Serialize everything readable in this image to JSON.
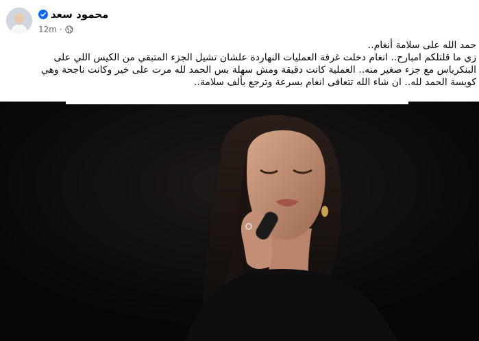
{
  "post": {
    "author": {
      "name": "محمود سعد",
      "verified": true,
      "avatar_icon": "person-avatar"
    },
    "meta": {
      "time": "12m",
      "separator": "·",
      "audience_icon": "globe-icon"
    },
    "text_lines": [
      "حمد الله على سلامة أنغام..",
      "زي ما قلتلكم امبارح.. انغام دخلت غرفة العمليات النهاردة علشان تشيل الجزء المتبقي من الكيس اللي على",
      "البنكرياس مع جزء صغير منه.. العملية كانت دقيقة ومش سهلة بس الحمد لله مرت على خير وكانت ناجحة وهي",
      "كويسة الحمد لله.. ان شاء الله تتعافى انغام بسرعة وترجع بألف سلامة.."
    ],
    "photo": {
      "description_icon": "singer-photo"
    }
  },
  "colors": {
    "text_primary": "#050505",
    "text_secondary": "#65676b",
    "verified_blue": "#0866ff",
    "photo_background": "#0b0b0b"
  }
}
